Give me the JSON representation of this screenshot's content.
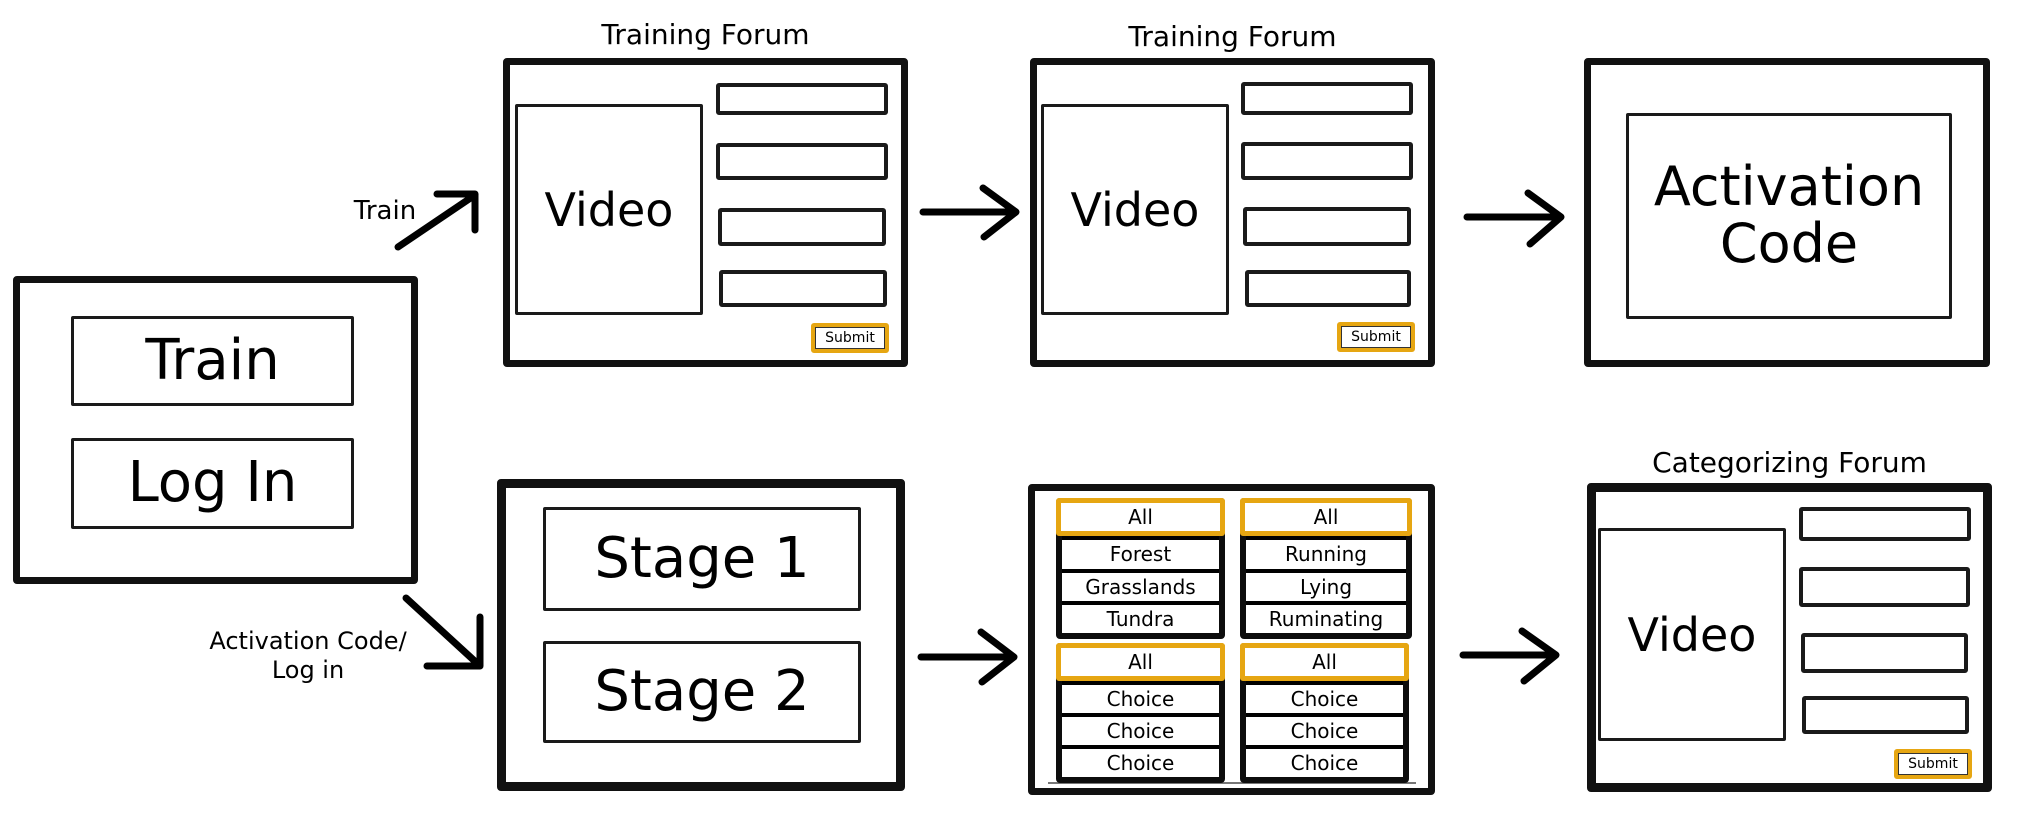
{
  "start_screen": {
    "buttons": [
      "Train",
      "Log In"
    ]
  },
  "transitions": {
    "train_label": "Train",
    "activation_label_line1": "Activation Code/",
    "activation_label_line2": "Log in"
  },
  "training_forum_1": {
    "title": "Training Forum",
    "video_label": "Video",
    "field_count": 4,
    "submit_label": "Submit"
  },
  "training_forum_2": {
    "title": "Training Forum",
    "video_label": "Video",
    "field_count": 4,
    "submit_label": "Submit"
  },
  "activation_screen": {
    "line1": "Activation",
    "line2": "Code"
  },
  "stage_screen": {
    "buttons": [
      "Stage 1",
      "Stage 2"
    ]
  },
  "filter_screen": {
    "lists": [
      {
        "items": [
          "All",
          "Forest",
          "Grasslands",
          "Tundra"
        ],
        "selected": 0
      },
      {
        "items": [
          "All",
          "Running",
          "Lying",
          "Ruminating"
        ],
        "selected": 0
      },
      {
        "items": [
          "All",
          "Choice",
          "Choice",
          "Choice"
        ],
        "selected": 0
      },
      {
        "items": [
          "All",
          "Choice",
          "Choice",
          "Choice"
        ],
        "selected": 0
      }
    ]
  },
  "categorizing_forum": {
    "title": "Categorizing Forum",
    "video_label": "Video",
    "field_count": 4,
    "submit_label": "Submit"
  },
  "colors": {
    "outline": "#111111",
    "highlight": "#e6a612",
    "background": "#ffffff"
  }
}
